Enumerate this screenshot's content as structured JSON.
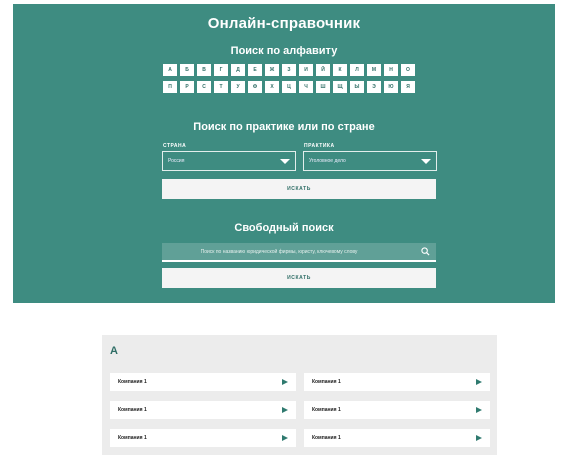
{
  "header": {
    "title": "Онлайн-справочник",
    "alphabet_heading": "Поиск по алфавиту",
    "alphabet_row1": [
      "А",
      "Б",
      "В",
      "Г",
      "Д",
      "Е",
      "Ж",
      "З",
      "И",
      "Й",
      "К",
      "Л",
      "М",
      "Н",
      "О"
    ],
    "alphabet_row2": [
      "П",
      "Р",
      "С",
      "Т",
      "У",
      "Ф",
      "Х",
      "Ц",
      "Ч",
      "Ш",
      "Щ",
      "Ы",
      "Э",
      "Ю",
      "Я"
    ]
  },
  "practice_search": {
    "heading": "Поиск по практике или по стране",
    "country_label": "СТРАНА",
    "country_value": "Россия",
    "practice_label": "ПРАКТИКА",
    "practice_value": "Уголовное дело",
    "search_button": "ИСКАТЬ"
  },
  "free_search": {
    "heading": "Свободный поиск",
    "placeholder": "Поиск по названию юридической фирмы, юристу, ключевому слову",
    "search_button": "ИСКАТЬ"
  },
  "results": {
    "letter": "А",
    "left": [
      "Компания 1",
      "Компания 1",
      "Компания 1"
    ],
    "right": [
      "Компания 1",
      "Компания 1",
      "Компания 1"
    ]
  },
  "colors": {
    "accent": "#3e8c81",
    "panel": "#ececec"
  },
  "icons": {
    "search": "search-icon",
    "arrow": "play-arrow-icon",
    "dropdown": "chevron-down-icon"
  }
}
